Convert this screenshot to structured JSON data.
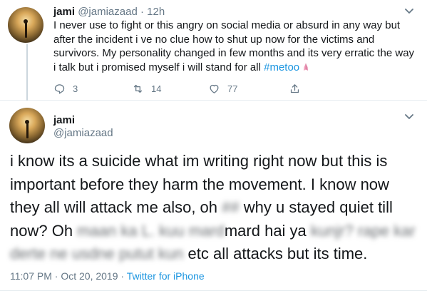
{
  "tweet1": {
    "name": "jami",
    "handle": "@jamiazaad",
    "separator": "·",
    "time": "12h",
    "text_line1": "I never use to fight or this angry on social media or absurd in any way but",
    "text_line2": "after the incident i ve no clue how to shut up now for the victims and",
    "text_line3": "survivors. My personality changed in few months and its very erratic the way",
    "text_line4": "i talk but i promised myself i will stand for all",
    "hashtag": "#metoo",
    "emoji_icon": "pink-praying-hands-emoji",
    "reply_count": "3",
    "retweet_count": "14",
    "like_count": "77",
    "icons": {
      "reply": "reply-icon",
      "retweet": "retweet-icon",
      "like": "heart-icon",
      "share": "share-icon",
      "menu": "chevron-down-icon"
    }
  },
  "tweet2": {
    "name": "jami",
    "handle": "@jamiazaad",
    "text_part1": "i know its a suicide what im writing right now but this is important before they harm the movement. I know now they all will attack me also, oh ",
    "blurred1": "##",
    "text_part2": " why u stayed quiet till now? Oh ",
    "blurred2": "maan ka L. kuu mard",
    "text_part3": "mard hai ya ",
    "blurred3": "kunjr? rape kar",
    "blurred4": "derte ne usdne putut kun",
    "text_part4": " etc all attacks but its time.",
    "timestamp": "11:07 PM · Oct 20, 2019",
    "meta_separator": "·",
    "source": "Twitter for iPhone"
  },
  "colors": {
    "link": "#1b95e0",
    "muted": "#657786",
    "text": "#14171a",
    "divider": "#e6ecf0"
  }
}
